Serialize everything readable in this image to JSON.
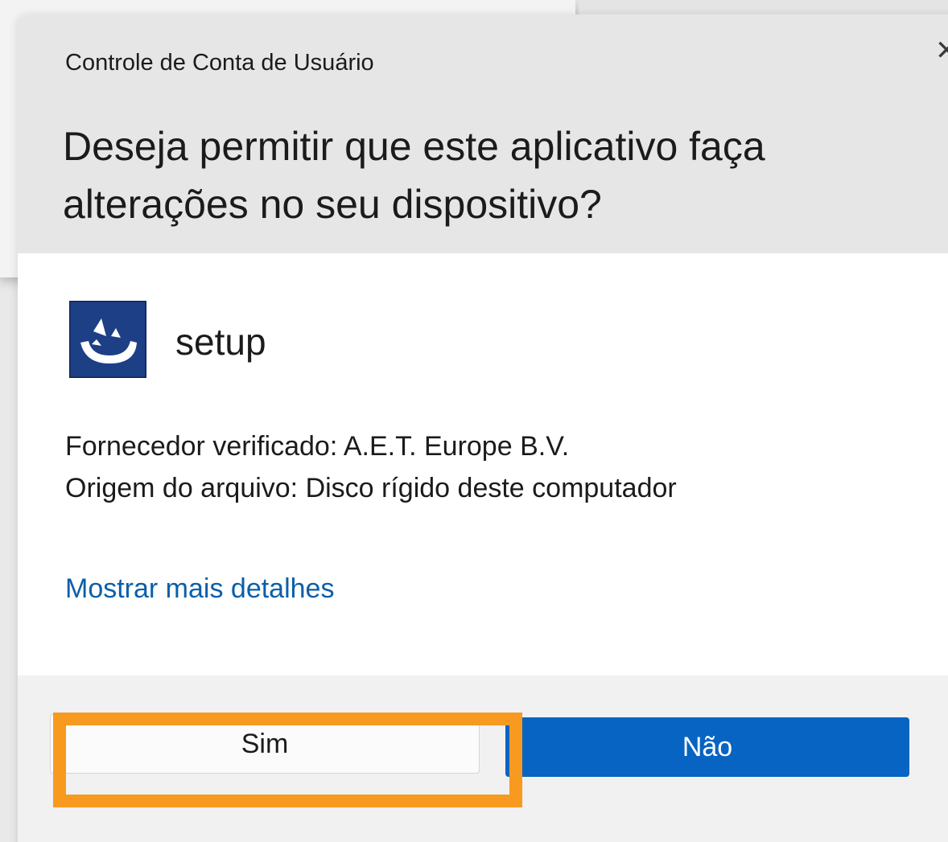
{
  "dialog": {
    "window_title": "Controle de Conta de Usuário",
    "close_glyph": "✕",
    "question": "Deseja permitir que este aplicativo faça alterações no seu dispositivo?",
    "app_name": "setup",
    "app_icon": "setup-app-icon",
    "publisher": "Fornecedor verificado: A.E.T. Europe B.V.",
    "origin": "Origem do arquivo: Disco rígido deste computador",
    "details_link": "Mostrar mais detalhes",
    "buttons": {
      "yes": "Sim",
      "no": "Não"
    }
  },
  "colors": {
    "header_bg": "#e6e6e6",
    "footer_bg": "#f1f1f1",
    "link": "#0a5faa",
    "primary_button": "#0764c2",
    "highlight": "#f79a1f"
  }
}
